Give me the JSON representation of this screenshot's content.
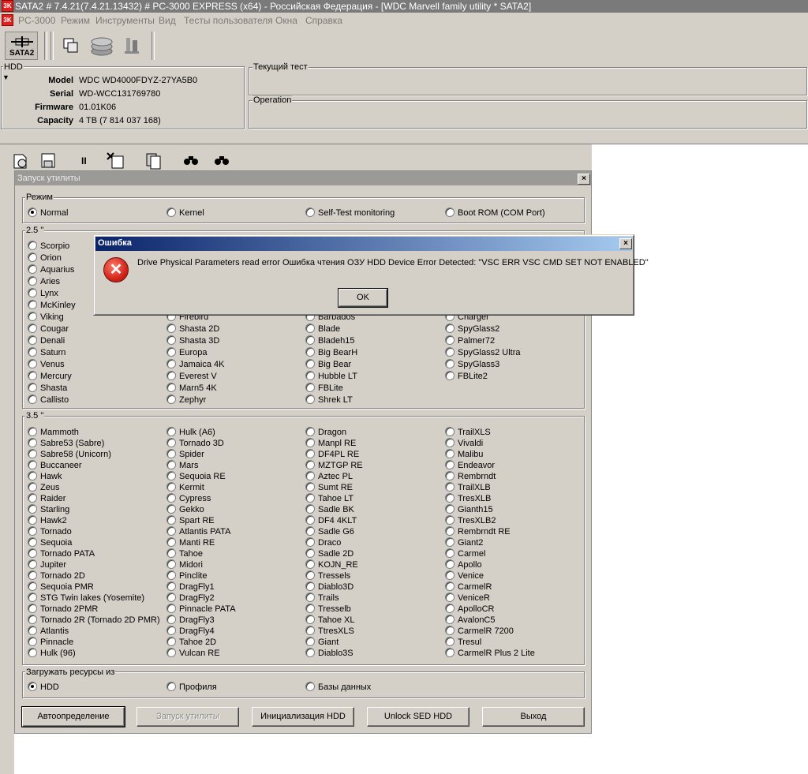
{
  "app": {
    "icon_text": "3K",
    "title": "SATA2 # 7.4.21(7.4.21.13432) # PC-3000 EXPRESS (x64) - Российская Федерация - [WDC Marvell family utility * SATA2]"
  },
  "menu": [
    "PC-3000",
    "Режим",
    "Инструменты",
    "Вид",
    "Тесты пользователя",
    "Окна",
    "Справка"
  ],
  "toolbar": {
    "sata_label": "SATA2"
  },
  "hdd": {
    "group_label": "HDD",
    "fields": [
      {
        "label": "Model",
        "value": "WDC WD4000FDYZ-27YA5B0"
      },
      {
        "label": "Serial",
        "value": "WD-WCC131769780"
      },
      {
        "label": "Firmware",
        "value": "01.01K06"
      },
      {
        "label": "Capacity",
        "value": "4 TB (7 814 037 168)"
      }
    ]
  },
  "current_test": {
    "label": "Текущий тест"
  },
  "operation": {
    "label": "Operation"
  },
  "window": {
    "title": "Запуск утилиты",
    "close": "×",
    "mode": {
      "label": "Режим",
      "options": [
        "Normal",
        "Kernel",
        "Self-Test monitoring",
        "Boot ROM (COM Port)"
      ],
      "selected": 0
    },
    "g25": {
      "label": "2.5 \"",
      "col1": [
        "Scorpio",
        "Orion",
        "Aquarius",
        "Aries",
        "Lynx",
        "McKinley",
        "Viking",
        "Cougar",
        "Denali",
        "Saturn",
        "Venus",
        "Mercury",
        "Shasta",
        "Callisto"
      ],
      "col2": [
        "Firebird",
        "Shasta 2D",
        "Shasta 3D",
        "Europa",
        "Jamaica 4K",
        "Everest V",
        "Marn5 4K",
        "Zephyr"
      ],
      "col3": [
        "Barbados",
        "Blade",
        "Bladeh15",
        "Big BearH",
        "Big Bear",
        "Hubble LT",
        "FBLite",
        "Shrek LT"
      ],
      "col4": [
        "Charger",
        "SpyGlass2",
        "Palmer72",
        "SpyGlass2 Ultra",
        "SpyGlass3",
        "FBLite2"
      ]
    },
    "g35": {
      "label": "3.5 \"",
      "col1": [
        "Mammoth",
        "Sabre53 (Sabre)",
        "Sabre58 (Unicorn)",
        "Buccaneer",
        "Hawk",
        "Zeus",
        "Raider",
        "Starling",
        "Hawk2",
        "Tornado",
        "Sequoia",
        "Tornado PATA",
        "Jupiter",
        "Tornado 2D",
        "Sequoia PMR",
        "STG Twin lakes (Yosemite)",
        "Tornado 2PMR",
        "Tornado 2R (Tornado 2D PMR)",
        "Atlantis",
        "Pinnacle",
        "Hulk (96)"
      ],
      "col2": [
        "Hulk (A6)",
        "Tornado 3D",
        "Spider",
        "Mars",
        "Sequoia RE",
        "Kermit",
        "Cypress",
        "Gekko",
        "Spart RE",
        "Atlantis PATA",
        "Manti RE",
        "Tahoe",
        "Midori",
        "Pinclite",
        "DragFly1",
        "DragFly2",
        "Pinnacle PATA",
        "DragFly3",
        "DragFly4",
        "Tahoe 2D",
        "Vulcan RE"
      ],
      "col3": [
        "Dragon",
        "Manpl RE",
        "DF4PL RE",
        "MZTGP RE",
        "Aztec PL",
        "Sumt RE",
        "Tahoe LT",
        "Sadle BK",
        "DF4 4KLT",
        "Sadle G6",
        "Draco",
        "Sadle 2D",
        "KOJN_RE",
        "Tressels",
        "Diablo3D",
        "Trails",
        "Tresselb",
        "Tahoe XL",
        "TtresXLS",
        "Giant",
        "Diablo3S"
      ],
      "col4": [
        "TrailXLS",
        "Vivaldi",
        "Malibu",
        "Endeavor",
        "Rembrndt",
        "TrailXLB",
        "TresXLB",
        "Gianth15",
        "TresXLB2",
        "Rembrndt RE",
        "Giant2",
        "Carmel",
        "Apollo",
        "Venice",
        "CarmelR",
        "VeniceR",
        "ApolloCR",
        "AvalonC5",
        "CarmelR 7200",
        "Tresul",
        "CarmelR Plus 2 Lite"
      ]
    },
    "resources": {
      "label": "Загружать ресурсы из",
      "options": [
        "HDD",
        "Профиля",
        "Базы данных"
      ],
      "selected": 0
    },
    "buttons": {
      "autodetect": "Автоопределение",
      "run": "Запуск утилиты",
      "init": "Инициализация HDD",
      "unlock": "Unlock SED HDD",
      "exit": "Выход"
    }
  },
  "dialog": {
    "title": "Ошибка",
    "close": "×",
    "message": "Drive Physical Parameters read error Ошибка чтения ОЗУ HDD Device Error Detected: \"VSC ERR VSC CMD SET NOT ENABLED\"",
    "ok": "OK",
    "icon": "error-icon"
  }
}
